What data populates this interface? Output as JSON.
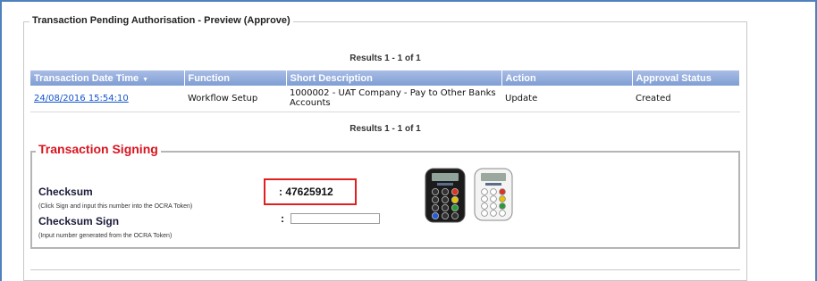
{
  "panel": {
    "title": "Transaction Pending Authorisation - Preview (Approve)"
  },
  "results_top": "Results 1 - 1 of 1",
  "results_bottom": "Results 1 - 1 of 1",
  "table": {
    "columns": [
      "Transaction Date Time",
      "Function",
      "Short Description",
      "Action",
      "Approval Status"
    ],
    "sort_indicator": "▼",
    "rows": [
      {
        "datetime": "24/08/2016 15:54:10",
        "function": "Workflow Setup",
        "description": "1000002 - UAT Company - Pay to Other Banks Accounts",
        "action": "Update",
        "status": "Created"
      }
    ]
  },
  "signing": {
    "title": "Transaction Signing",
    "checksum_label": "Checksum",
    "checksum_hint": "(Click Sign and input this number into the OCRA Token)",
    "checksum_value": ": 47625912",
    "checksum_sign_label": "Checksum Sign",
    "checksum_sign_hint": "(Input number generated from the OCRA Token)",
    "colon": ":",
    "checksum_sign_value": ""
  },
  "colors": {
    "frame_border": "#4f81bd",
    "table_header": "#8ea9db",
    "signing_title": "#d9141f",
    "highlight_box": "#e02020",
    "link": "#1155cc"
  },
  "icons": [
    "ocra-token-black-icon",
    "ocra-token-white-icon",
    "sort-desc-icon"
  ]
}
